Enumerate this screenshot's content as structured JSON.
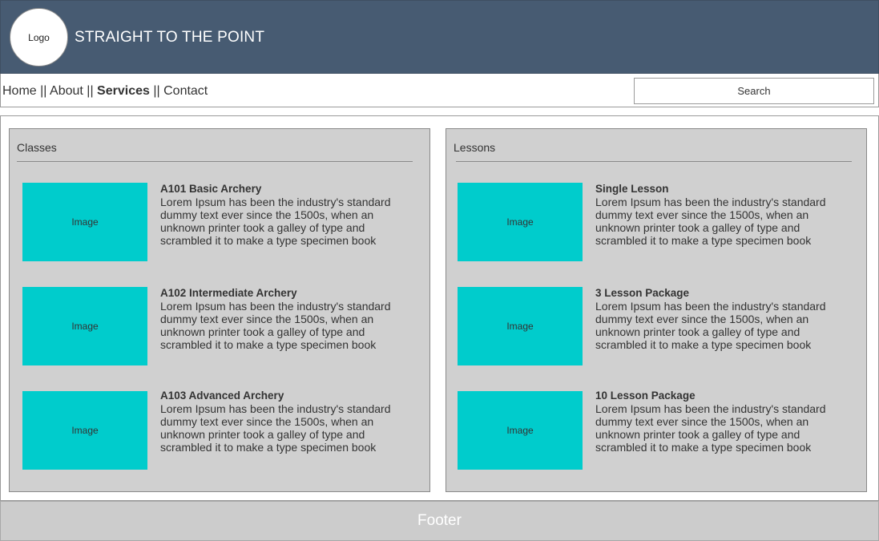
{
  "header": {
    "logo_label": "Logo",
    "title": "STRAIGHT TO THE POINT"
  },
  "nav": {
    "items": [
      {
        "label": "Home"
      },
      {
        "label": "About"
      },
      {
        "label": "Services"
      },
      {
        "label": "Contact"
      }
    ],
    "separator": "||",
    "active": "Services"
  },
  "search": {
    "label": "Search"
  },
  "classes": {
    "title": "Classes",
    "items": [
      {
        "image_label": "Image",
        "name": "A101 Basic Archery",
        "description": "Lorem Ipsum has been the industry's standard dummy text ever since the 1500s, when an unknown printer took a galley of type and scrambled it to make a type specimen book"
      },
      {
        "image_label": "Image",
        "name": "A102 Intermediate Archery",
        "description": "Lorem Ipsum has been the industry's standard dummy text ever since the 1500s, when an unknown printer took a galley of type and scrambled it to make a type specimen book"
      },
      {
        "image_label": "Image",
        "name": "A103 Advanced Archery",
        "description": "Lorem Ipsum has been the industry's standard dummy text ever since the 1500s, when an unknown printer took a galley of type and scrambled it to make a type specimen book"
      }
    ]
  },
  "lessons": {
    "title": "Lessons",
    "items": [
      {
        "image_label": "Image",
        "name": "Single Lesson",
        "description": "Lorem Ipsum has been the industry's standard dummy text ever since the 1500s, when an unknown printer took a galley of type and scrambled it to make a type specimen book"
      },
      {
        "image_label": "Image",
        "name": "3 Lesson Package",
        "description": "Lorem Ipsum has been the industry's standard dummy text ever since the 1500s, when an unknown printer took a galley of type and scrambled it to make a type specimen book"
      },
      {
        "image_label": "Image",
        "name": "10 Lesson Package",
        "description": "Lorem Ipsum has been the industry's standard dummy text ever since the 1500s, when an unknown printer took a galley of type and scrambled it to make a type specimen book"
      }
    ]
  },
  "footer": {
    "label": "Footer"
  },
  "colors": {
    "header_bg": "#475b72",
    "image_placeholder": "#00cccc",
    "panel_bg": "#d0d0d0",
    "footer_bg": "#cccccc"
  }
}
